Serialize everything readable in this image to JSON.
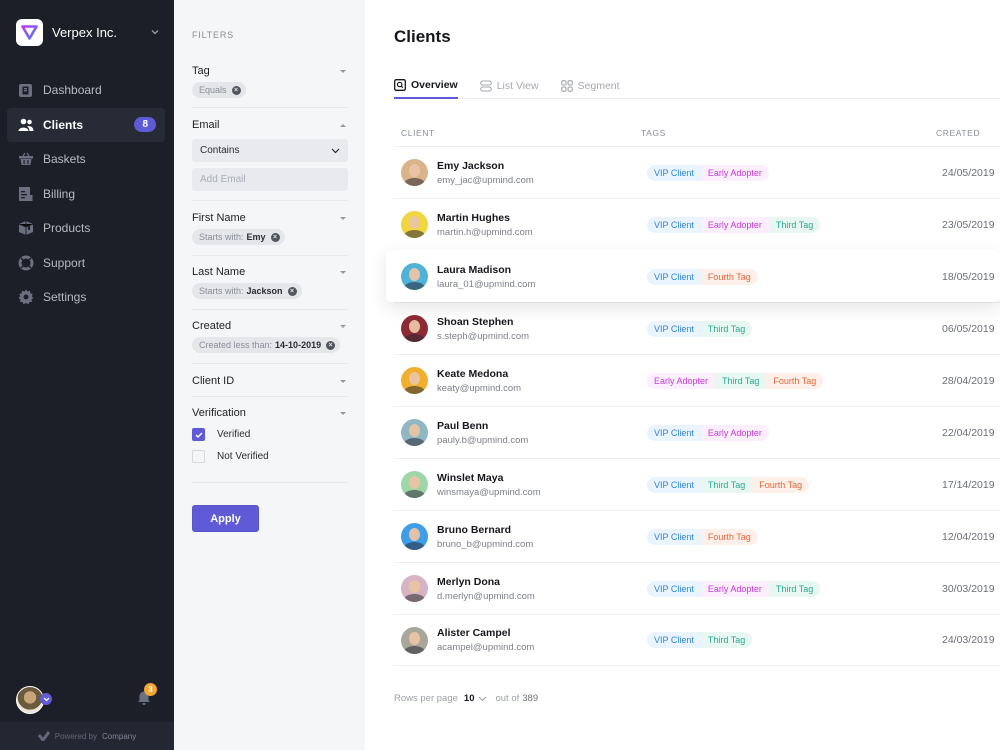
{
  "sidebar": {
    "brand": {
      "name": "Verpex Inc.",
      "logo_icon": "verpex-triangle-logo",
      "menu_icon": "chevron-down-icon"
    },
    "items": [
      {
        "label": "Dashboard",
        "icon": "dashboard-icon",
        "active": false
      },
      {
        "label": "Clients",
        "icon": "users-icon",
        "active": true,
        "badge": "8"
      },
      {
        "label": "Baskets",
        "icon": "basket-icon",
        "active": false
      },
      {
        "label": "Billing",
        "icon": "billing-icon",
        "active": false
      },
      {
        "label": "Products",
        "icon": "box-icon",
        "active": false
      },
      {
        "label": "Support",
        "icon": "lifebuoy-icon",
        "active": false
      },
      {
        "label": "Settings",
        "icon": "gear-icon",
        "active": false
      }
    ],
    "notifications_count": "3",
    "powered_by": "Powered by",
    "powered_company": "Company"
  },
  "filters": {
    "title": "FILTERS",
    "tag": {
      "label": "Tag",
      "chip": "Equals"
    },
    "email": {
      "label": "Email",
      "operator": "Contains",
      "placeholder": "Add Email"
    },
    "first_name": {
      "label": "First Name",
      "chip_prefix": "Starts with:",
      "chip_value": "Emy"
    },
    "last_name": {
      "label": "Last Name",
      "chip_prefix": "Starts with:",
      "chip_value": "Jackson"
    },
    "created": {
      "label": "Created",
      "chip_prefix": "Created less than:",
      "chip_value": "14-10-2019"
    },
    "client_id": {
      "label": "Client ID"
    },
    "verification": {
      "label": "Verification",
      "options": [
        {
          "label": "Verified",
          "checked": true
        },
        {
          "label": "Not Verified",
          "checked": false
        }
      ]
    },
    "apply_label": "Apply"
  },
  "main": {
    "title": "Clients",
    "tabs": [
      {
        "label": "Overview",
        "icon": "search-square-icon",
        "active": true
      },
      {
        "label": "List View",
        "icon": "list-view-icon",
        "active": false
      },
      {
        "label": "Segment",
        "icon": "grid-icon",
        "active": false
      }
    ],
    "columns": {
      "client": "CLIENT",
      "tags": "TAGS",
      "created": "CREATED"
    },
    "tag_styles": {
      "VIP Client": {
        "color": "#2f86d8",
        "bg": "#eaf4fe"
      },
      "Early Adopter": {
        "color": "#c43ad6",
        "bg": "#fbeffd"
      },
      "Third Tag": {
        "color": "#2aa98f",
        "bg": "#e9f7f3"
      },
      "Fourth Tag": {
        "color": "#e2683a",
        "bg": "#fdf0ea"
      }
    },
    "rows": [
      {
        "name": "Emy Jackson",
        "email": "emy_jac@upmind.com",
        "tags": [
          "VIP Client",
          "Early Adopter"
        ],
        "created": "24/05/2019",
        "avatar_bg": "#d9b48a"
      },
      {
        "name": "Martin Hughes",
        "email": "martin.h@upmind.com",
        "tags": [
          "VIP Client",
          "Early Adopter",
          "Third Tag"
        ],
        "created": "23/05/2019",
        "avatar_bg": "#f2d640"
      },
      {
        "name": "Laura Madison",
        "email": "laura_01@upmind.com",
        "tags": [
          "VIP Client",
          "Fourth Tag"
        ],
        "created": "18/05/2019",
        "avatar_bg": "#4fb3d9",
        "hover": true
      },
      {
        "name": "Shoan Stephen",
        "email": "s.steph@upmind.com",
        "tags": [
          "VIP Client",
          "Third Tag"
        ],
        "created": "06/05/2019",
        "avatar_bg": "#8e2a35"
      },
      {
        "name": "Keate Medona",
        "email": "keaty@upmind.com",
        "tags": [
          "Early Adopter",
          "Third Tag",
          "Fourth Tag"
        ],
        "created": "28/04/2019",
        "avatar_bg": "#f0b02e"
      },
      {
        "name": "Paul Benn",
        "email": "pauly.b@upmind.com",
        "tags": [
          "VIP Client",
          "Early Adopter"
        ],
        "created": "22/04/2019",
        "avatar_bg": "#8fb7c4"
      },
      {
        "name": "Winslet Maya",
        "email": "winsmaya@upmind.com",
        "tags": [
          "VIP Client",
          "Third Tag",
          "Fourth Tag"
        ],
        "created": "17/14/2019",
        "avatar_bg": "#9fd6a8"
      },
      {
        "name": "Bruno Bernard",
        "email": "bruno_b@upmind.com",
        "tags": [
          "VIP Client",
          "Fourth Tag"
        ],
        "created": "12/04/2019",
        "avatar_bg": "#3f9ee8"
      },
      {
        "name": "Merlyn Dona",
        "email": "d.merlyn@upmind.com",
        "tags": [
          "VIP Client",
          "Early Adopter",
          "Third Tag"
        ],
        "created": "30/03/2019",
        "avatar_bg": "#d7b3c3"
      },
      {
        "name": "Alister Campel",
        "email": "acampel@upmind.com",
        "tags": [
          "VIP Client",
          "Third Tag"
        ],
        "created": "24/03/2019",
        "avatar_bg": "#a9a79c"
      }
    ],
    "pagination": {
      "rows_label": "Rows per page",
      "rows_value": "10",
      "out_of_label": "out of",
      "total": "389"
    }
  },
  "colors": {
    "accent": "#5f5bd7",
    "sidebar_bg": "#1c1f27",
    "filters_bg": "#f5f6f8",
    "notification": "#f3a630"
  }
}
